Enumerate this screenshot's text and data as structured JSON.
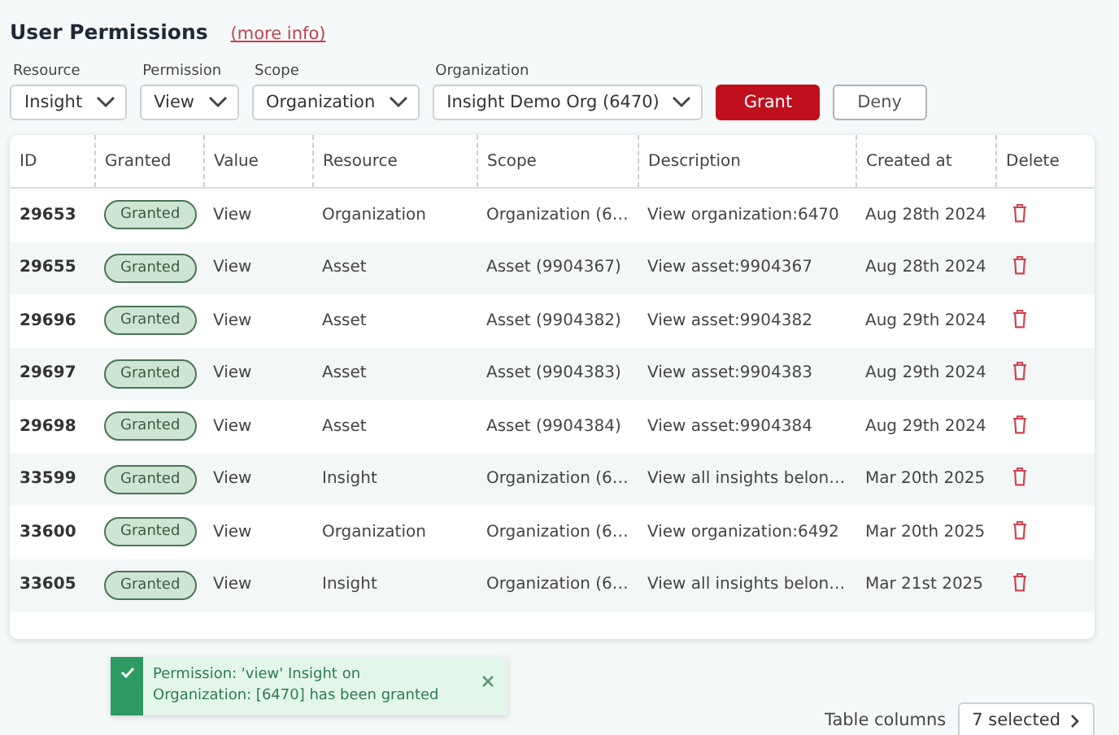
{
  "header": {
    "title": "User Permissions",
    "link": "(more info)"
  },
  "filters": [
    {
      "label": "Resource",
      "value": "Insight"
    },
    {
      "label": "Permission",
      "value": "View"
    },
    {
      "label": "Scope",
      "value": "Organization"
    },
    {
      "label": "Organization",
      "value": "Insight Demo Org (6470)"
    }
  ],
  "buttons": [
    {
      "label": "Grant",
      "kind": "primary"
    },
    {
      "label": "Deny",
      "kind": "secondary"
    }
  ],
  "table": {
    "columns": [
      "ID",
      "Granted",
      "Value",
      "Resource",
      "Scope",
      "Description",
      "Created at",
      "Delete"
    ],
    "rows": [
      {
        "id": "29653",
        "granted": "Granted",
        "value": "View",
        "resource": "Organization",
        "scope": "Organization (6…",
        "description": "View organization:6470",
        "created": "Aug 28th 2024"
      },
      {
        "id": "29655",
        "granted": "Granted",
        "value": "View",
        "resource": "Asset",
        "scope": "Asset (9904367)",
        "description": "View asset:9904367",
        "created": "Aug 28th 2024"
      },
      {
        "id": "29696",
        "granted": "Granted",
        "value": "View",
        "resource": "Asset",
        "scope": "Asset (9904382)",
        "description": "View asset:9904382",
        "created": "Aug 29th 2024"
      },
      {
        "id": "29697",
        "granted": "Granted",
        "value": "View",
        "resource": "Asset",
        "scope": "Asset (9904383)",
        "description": "View asset:9904383",
        "created": "Aug 29th 2024"
      },
      {
        "id": "29698",
        "granted": "Granted",
        "value": "View",
        "resource": "Asset",
        "scope": "Asset (9904384)",
        "description": "View asset:9904384",
        "created": "Aug 29th 2024"
      },
      {
        "id": "33599",
        "granted": "Granted",
        "value": "View",
        "resource": "Insight",
        "scope": "Organization (6…",
        "description": "View all insights belon…",
        "created": "Mar 20th 2025"
      },
      {
        "id": "33600",
        "granted": "Granted",
        "value": "View",
        "resource": "Organization",
        "scope": "Organization (6…",
        "description": "View organization:6492",
        "created": "Mar 20th 2025"
      },
      {
        "id": "33605",
        "granted": "Granted",
        "value": "View",
        "resource": "Insight",
        "scope": "Organization (6…",
        "description": "View all insights belon…",
        "created": "Mar 21st 2025"
      }
    ]
  },
  "toast": {
    "kind": "success",
    "message": "Permission: 'view' Insight on Organization: [6470] has been granted"
  },
  "footer": {
    "label": "Table columns",
    "select": "7 selected"
  }
}
